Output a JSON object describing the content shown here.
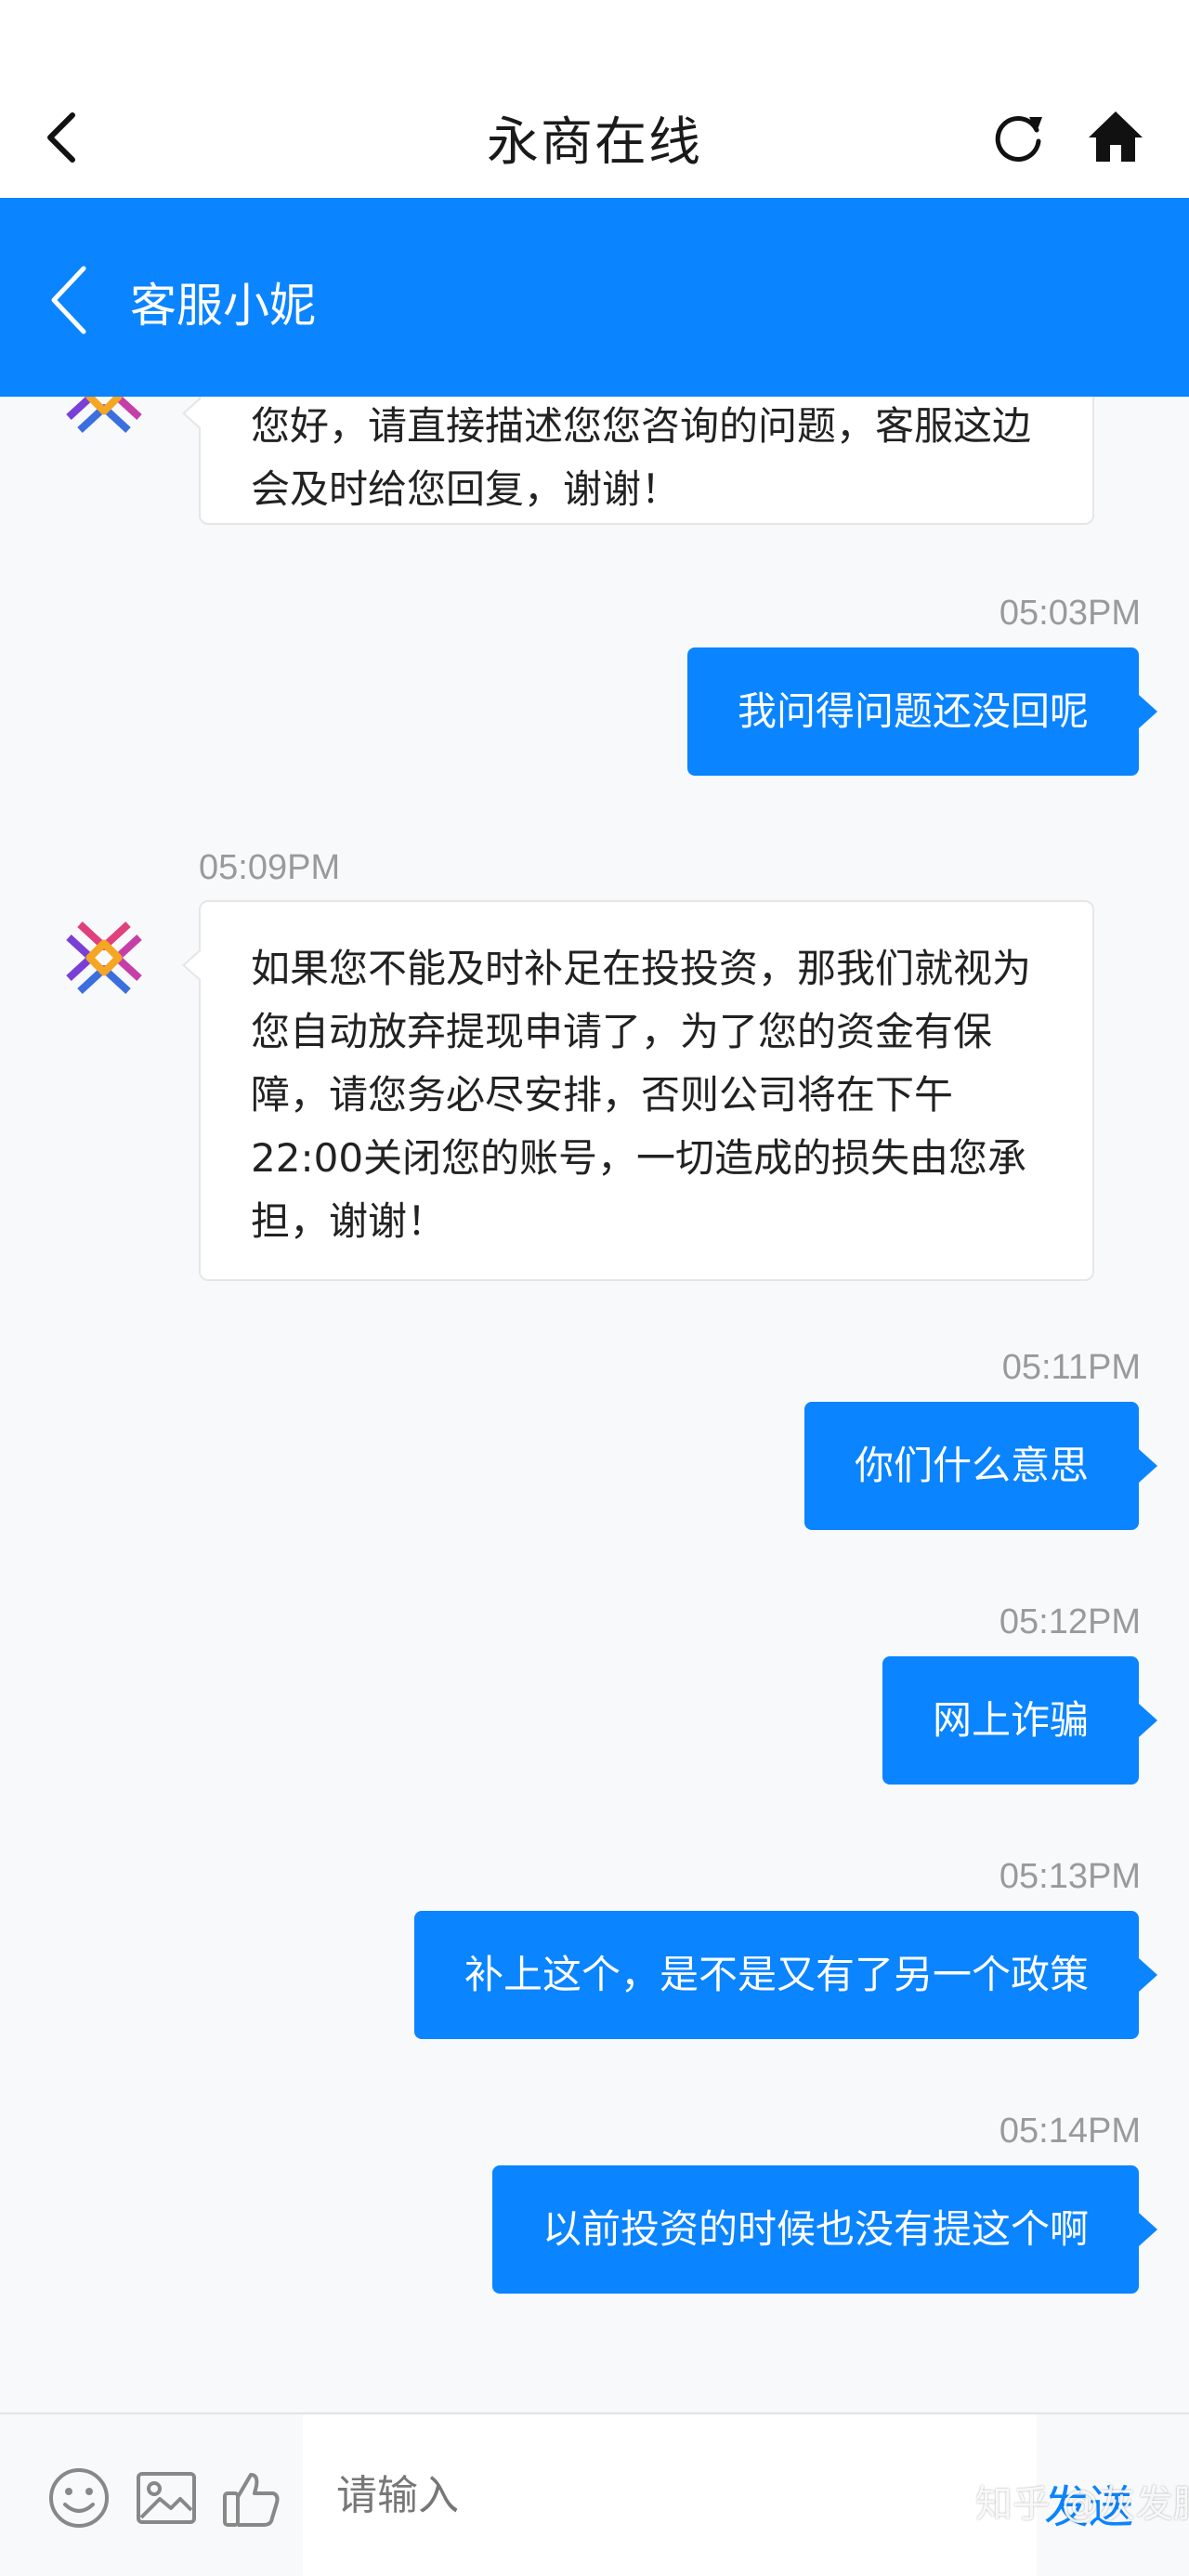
{
  "header": {
    "title": "永商在线"
  },
  "chat_header": {
    "name": "客服小妮"
  },
  "messages": [
    {
      "side": "in",
      "text": "您好，请直接描述您您咨询的问题，客服这边会及时给您回复，谢谢！"
    },
    {
      "side": "out",
      "time": "05:03PM",
      "text": "我问得问题还没回呢"
    },
    {
      "side": "in",
      "time": "05:09PM",
      "text": "如果您不能及时补足在投投资，那我们就视为您自动放弃提现申请了，为了您的资金有保障，请您务必尽安排，否则公司将在下午22:00关闭您的账号，一切造成的损失由您承担，谢谢！"
    },
    {
      "side": "out",
      "time": "05:11PM",
      "text": "你们什么意思"
    },
    {
      "side": "out",
      "time": "05:12PM",
      "text": "网上诈骗"
    },
    {
      "side": "out",
      "time": "05:13PM",
      "text": "补上这个，是不是又有了另一个政策"
    },
    {
      "side": "out",
      "time": "05:14PM",
      "text": "以前投资的时候也没有提这个啊"
    }
  ],
  "input": {
    "placeholder": "请输入",
    "send_label": "发送"
  },
  "watermark": "知乎 @灰发肥",
  "colors": {
    "accent": "#0a84ff",
    "background": "#f8f9fa",
    "bubble_in": "#ffffff"
  },
  "icons": [
    "back-chevron-icon",
    "refresh-icon",
    "home-icon",
    "emoji-icon",
    "image-icon",
    "thumbs-up-icon"
  ]
}
